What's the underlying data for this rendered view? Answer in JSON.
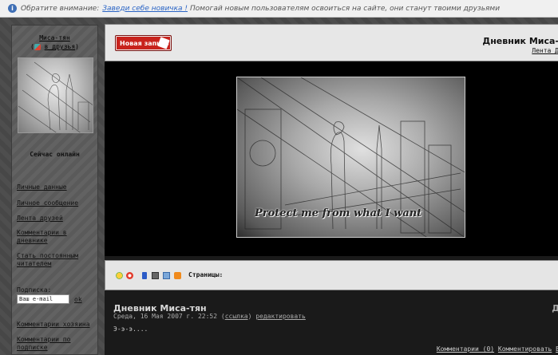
{
  "notice": {
    "label": "Обратите внимание:",
    "link": "Заведи себе новичка !",
    "text": "Помогай новым пользователям освоиться на сайте, они станут твоими друзьями"
  },
  "sidebar": {
    "user_name": "Миса-тян",
    "add_friend": "в друзья",
    "online_status": "Сейчас онлайн",
    "links": [
      "Личные данные",
      "Личное сообщение",
      "Лента друзей",
      "Комментарии в дневнике",
      "Стать постоянным читателем"
    ],
    "subscribe_label": "Подписка:",
    "email_placeholder": "Ваш e-mail",
    "ok_label": "ok",
    "bottom_links": [
      "Комментарии хозяина",
      "Комментарии по подписке"
    ]
  },
  "header": {
    "new_post_label": "Новая запись",
    "diary_title": "Дневник Миса-",
    "feed_link": "Лента Д"
  },
  "banner": {
    "caption": "Protect me from what I want"
  },
  "toolbar": {
    "pages_label": "Страницы:"
  },
  "post": {
    "title": "Дневник Миса-тян",
    "date": "Среда, 16 Мая 2007 г. 22:52",
    "link_label": "ссылка",
    "edit_label": "редактировать",
    "body": "Э-э-э....",
    "comments_label": "Комментарии (0)",
    "comment_action": "Комментировать",
    "trailing": "В"
  }
}
